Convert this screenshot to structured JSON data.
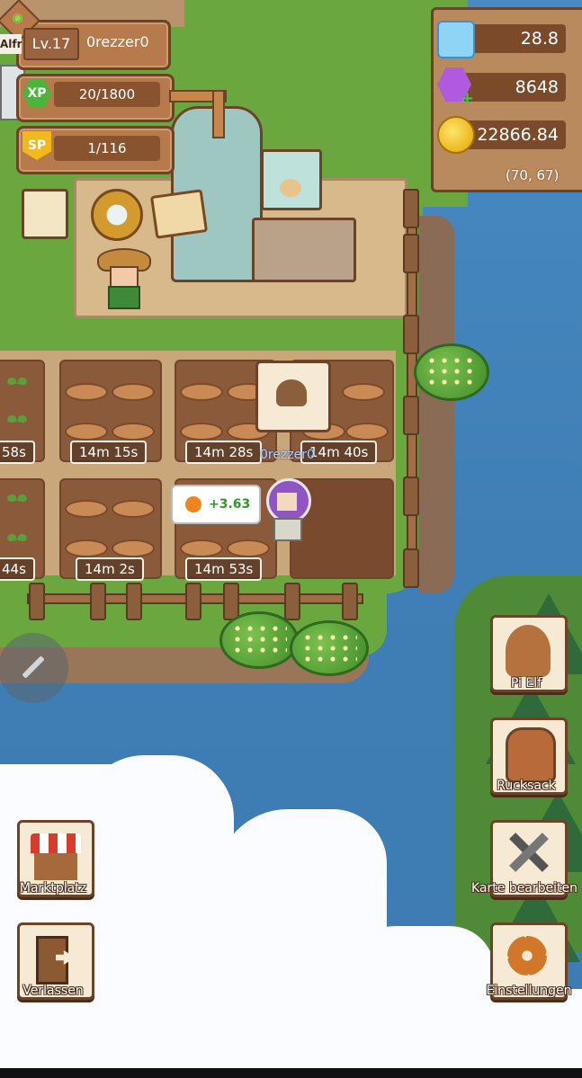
{
  "hud": {
    "level": "Lv.17",
    "player_name": "0rezzer0",
    "xp_label": "XP",
    "xp_value": "20/1800",
    "sp_label": "SP",
    "sp_value": "1/116",
    "side_name_fragment": "Alfr"
  },
  "resources": {
    "crystal": "28.8",
    "gems": "8648",
    "coins": "22866.84",
    "coordinates": "(70, 67)"
  },
  "farm": {
    "player_tag": "0rezzer0",
    "yield_text": "+3.63",
    "timers_row1": [
      "58s",
      "14m 15s",
      "14m 28s",
      "14m 40s"
    ],
    "timers_row2": [
      "44s",
      "14m 2s",
      "14m 53s"
    ]
  },
  "menu_right": {
    "pi_elf": "Pi Elf",
    "backpack": "Rucksack",
    "edit_map": "Karte bearbeiten",
    "settings": "Einstellungen"
  },
  "menu_left": {
    "market": "Marktplatz",
    "leave": "Verlassen"
  }
}
